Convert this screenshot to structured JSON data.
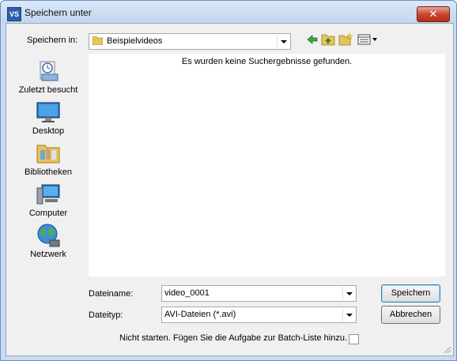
{
  "window": {
    "title": "Speichern unter",
    "app_icon": "VS",
    "close_label": "✕"
  },
  "toolbar": {
    "location_label": "Speichern in:",
    "location_value": "Beispielvideos",
    "icons": [
      "back-arrow-icon",
      "up-folder-icon",
      "new-folder-icon",
      "view-menu-icon"
    ]
  },
  "places": [
    {
      "label": "Zuletzt besucht",
      "icon": "recent-places-icon"
    },
    {
      "label": "Desktop",
      "icon": "desktop-icon"
    },
    {
      "label": "Bibliotheken",
      "icon": "libraries-icon"
    },
    {
      "label": "Computer",
      "icon": "computer-icon"
    },
    {
      "label": "Netzwerk",
      "icon": "network-icon"
    }
  ],
  "filelist": {
    "empty_message": "Es wurden keine Suchergebnisse gefunden."
  },
  "form": {
    "filename_label": "Dateiname:",
    "filename_value": "video_0001",
    "filetype_label": "Dateityp:",
    "filetype_value": "AVI-Dateien (*.avi)",
    "save_label": "Speichern",
    "cancel_label": "Abbrechen",
    "batch_option_label": "Nicht starten. Fügen Sie die Aufgabe zur Batch-Liste hinzu.",
    "batch_option_checked": false
  },
  "colors": {
    "title_bar": "#c9daf0",
    "close_button": "#c8472f",
    "dialog_bg": "#f0f0f0"
  }
}
